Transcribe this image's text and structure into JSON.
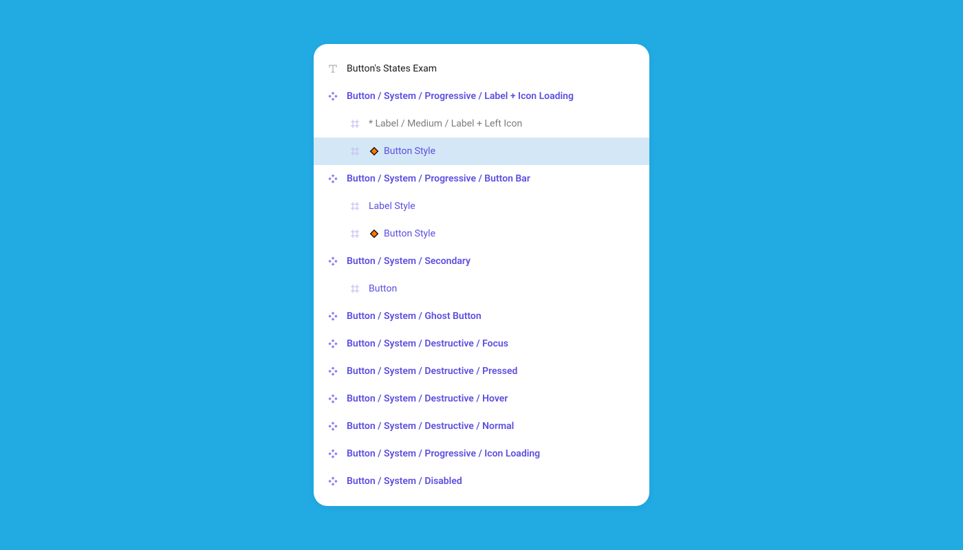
{
  "colors": {
    "background": "#22aae3",
    "panel": "#ffffff",
    "selected": "#d4e7f6",
    "component": "#5b4ee0",
    "text": "#1a1a1a",
    "muted": "#7c7c7c",
    "diamondFill": "#ff7a00",
    "diamondStroke": "#000000"
  },
  "rows": [
    {
      "icon": "text",
      "label": "Button's States Exam",
      "style": "text",
      "indent": 0,
      "diamond": false,
      "selected": false
    },
    {
      "icon": "component",
      "label": "Button / System / Progressive / Label + Icon Loading",
      "style": "component",
      "indent": 0,
      "diamond": false,
      "selected": false
    },
    {
      "icon": "frame",
      "label": "* Label / Medium / Label + Left Icon",
      "style": "frame-muted",
      "indent": 1,
      "diamond": false,
      "selected": false
    },
    {
      "icon": "frame",
      "label": "Button Style",
      "style": "frame",
      "indent": 1,
      "diamond": true,
      "selected": true
    },
    {
      "icon": "component",
      "label": "Button / System / Progressive / Button Bar",
      "style": "component",
      "indent": 0,
      "diamond": false,
      "selected": false
    },
    {
      "icon": "frame",
      "label": "Label Style",
      "style": "frame",
      "indent": 1,
      "diamond": false,
      "selected": false
    },
    {
      "icon": "frame",
      "label": "Button Style",
      "style": "frame",
      "indent": 1,
      "diamond": true,
      "selected": false
    },
    {
      "icon": "component",
      "label": "Button / System / Secondary",
      "style": "component",
      "indent": 0,
      "diamond": false,
      "selected": false
    },
    {
      "icon": "frame",
      "label": "Button",
      "style": "frame",
      "indent": 1,
      "diamond": false,
      "selected": false
    },
    {
      "icon": "component",
      "label": "Button / System / Ghost Button",
      "style": "component",
      "indent": 0,
      "diamond": false,
      "selected": false
    },
    {
      "icon": "component",
      "label": "Button / System / Destructive / Focus",
      "style": "component",
      "indent": 0,
      "diamond": false,
      "selected": false
    },
    {
      "icon": "component",
      "label": "Button / System / Destructive / Pressed",
      "style": "component",
      "indent": 0,
      "diamond": false,
      "selected": false
    },
    {
      "icon": "component",
      "label": "Button / System / Destructive / Hover",
      "style": "component",
      "indent": 0,
      "diamond": false,
      "selected": false
    },
    {
      "icon": "component",
      "label": "Button / System / Destructive / Normal",
      "style": "component",
      "indent": 0,
      "diamond": false,
      "selected": false
    },
    {
      "icon": "component",
      "label": "Button / System / Progressive / Icon Loading",
      "style": "component",
      "indent": 0,
      "diamond": false,
      "selected": false
    },
    {
      "icon": "component",
      "label": "Button / System / Disabled",
      "style": "component",
      "indent": 0,
      "diamond": false,
      "selected": false
    }
  ]
}
